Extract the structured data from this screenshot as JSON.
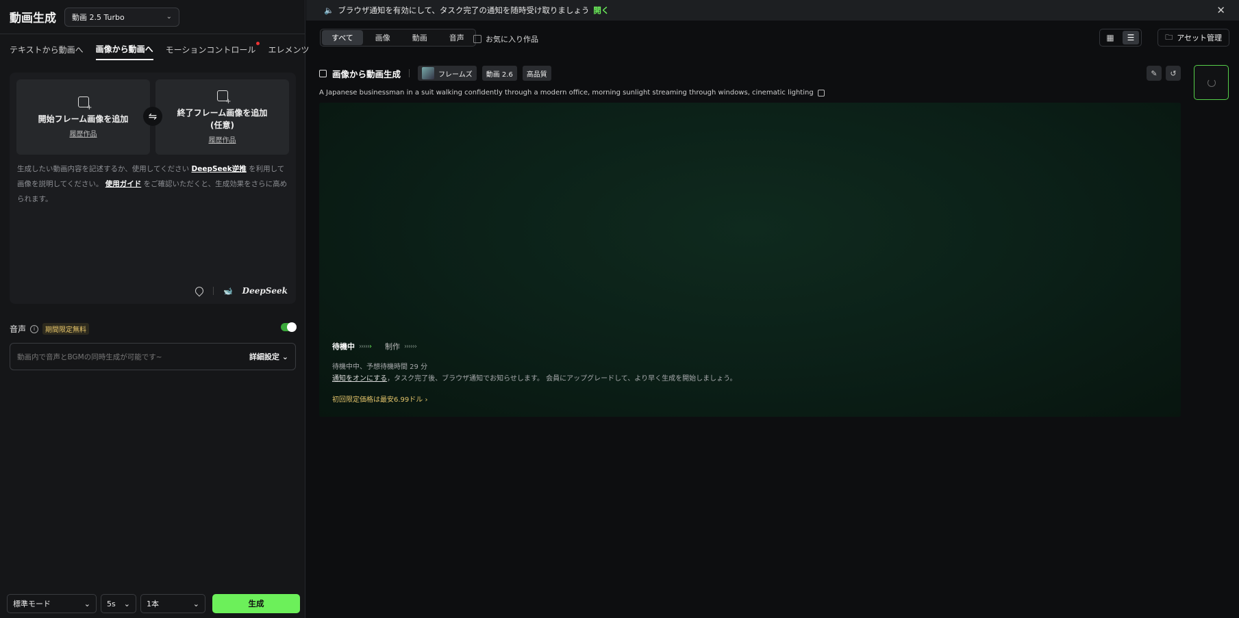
{
  "left": {
    "app_title": "動画生成",
    "model": "動画 2.5 Turbo",
    "mode_tabs": [
      "テキストから動画へ",
      "画像から動画へ",
      "モーションコントロール",
      "エレメンツ"
    ],
    "start_frame": {
      "title": "開始フレーム画像を追加",
      "history": "履歴作品"
    },
    "end_frame": {
      "title_line1": "終了フレーム画像を追加",
      "title_line2": "(任意)",
      "history": "履歴作品"
    },
    "desc": {
      "part1": "生成したい動画内容を記述するか、使用してください ",
      "link1": "DeepSeek逆推",
      "part2": " を利用して画像を説明してください。 ",
      "link2": "使用ガイド",
      "part3": " をご確認いただくと、生成効果をさらに高められます。"
    },
    "deepseek_label": "DeepSeek",
    "audio": {
      "label": "音声",
      "badge": "期間限定無料",
      "placeholder": "動画内で音声とBGMの同時生成が可能です~",
      "advanced": "詳細設定"
    },
    "bottom": {
      "mode": "標準モード",
      "duration": "5s",
      "count": "1本",
      "generate": "生成"
    }
  },
  "notice": {
    "text": "ブラウザ通知を有効にして、タスク完了の通知を随時受け取りましょう",
    "open": "開く",
    "close": "✕"
  },
  "filters": {
    "tabs": [
      "すべて",
      "画像",
      "動画",
      "音声"
    ],
    "favorites": "お気に入り作品",
    "asset_button": "アセット管理"
  },
  "task": {
    "title": "画像から動画生成",
    "chips": [
      "フレームズ",
      "動画 2.6",
      "高品質"
    ],
    "prompt": "A Japanese businessman in a suit walking confidently through a modern office, morning sunlight streaming through windows, cinematic lighting",
    "status_waiting": "待機中",
    "status_making": "制作",
    "wait_line1": "待機中中、予想待機時間 29 分",
    "wait_link": "通知をオンにする",
    "wait_line2": "，タスク完了後、ブラウザ通知でお知らせします。 会員にアップグレードして、より早く生成を開始しましょう。",
    "promo": "初回限定価格は最安6.99ドル  ›"
  },
  "colors": {
    "accent": "#6cf05a",
    "badge_text": "#e8c66a",
    "promo": "#e2c36a"
  }
}
